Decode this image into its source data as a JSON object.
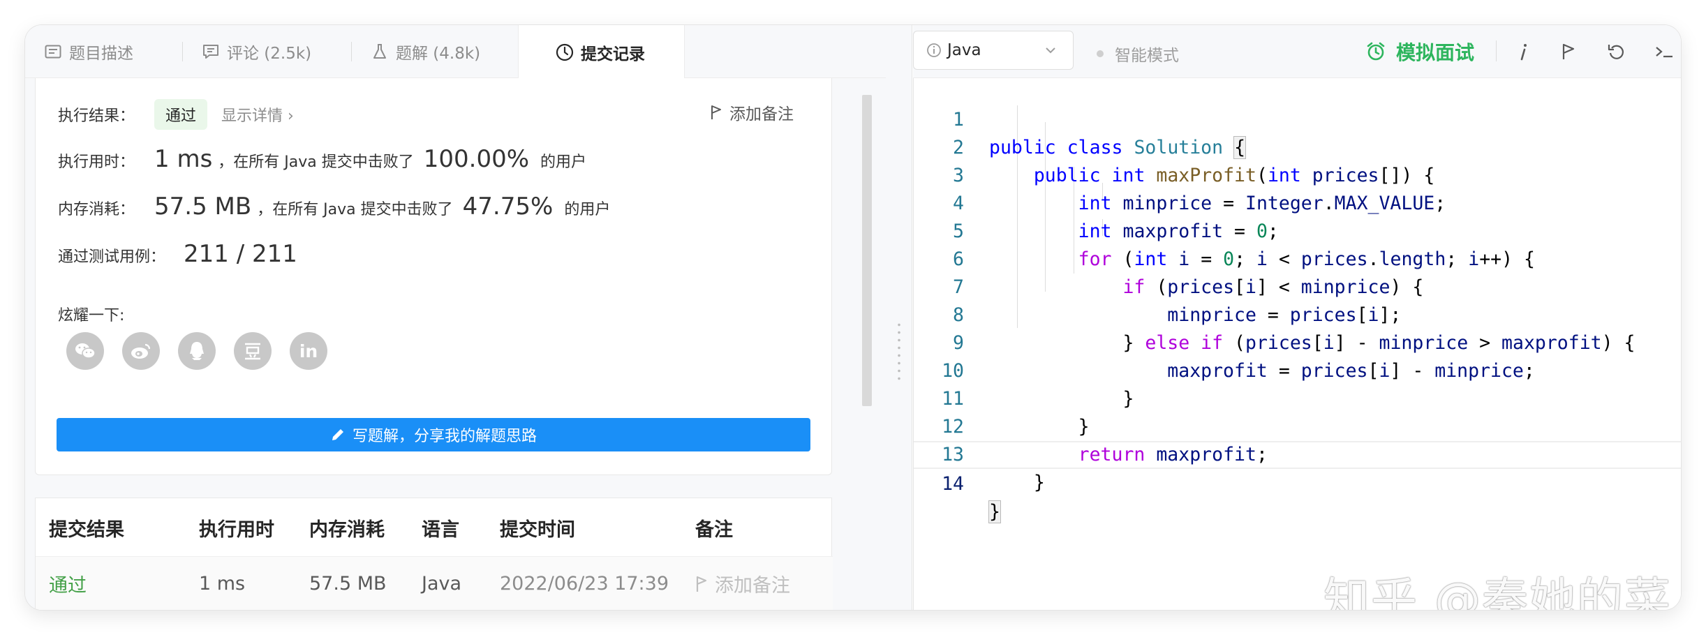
{
  "tabs": [
    {
      "label": "题目描述",
      "icon": "description-icon",
      "active": false
    },
    {
      "label": "评论 (2.5k)",
      "icon": "comment-icon",
      "active": false
    },
    {
      "label": "题解 (4.8k)",
      "icon": "flask-icon",
      "active": false
    },
    {
      "label": "提交记录",
      "icon": "clock-icon",
      "active": true
    }
  ],
  "result": {
    "status_label": "执行结果：",
    "status": "通过",
    "details_link": "显示详情 ›",
    "add_note": "添加备注",
    "time_label": "执行用时：",
    "time_value": "1 ms",
    "time_text": "，在所有 Java 提交中击败了",
    "time_percent": "100.00%",
    "time_suffix": "的用户",
    "mem_label": "内存消耗：",
    "mem_value": "57.5 MB",
    "mem_text": "，在所有 Java 提交中击败了",
    "mem_percent": "47.75%",
    "mem_suffix": "的用户",
    "tests_label": "通过测试用例：",
    "tests_value": "211 / 211",
    "share_label": "炫耀一下:",
    "share_icons": [
      "wechat-icon",
      "weibo-icon",
      "qq-icon",
      "douban-icon",
      "linkedin-icon"
    ],
    "write_button": "写题解，分享我的解题思路"
  },
  "submissions": {
    "headers": [
      "提交结果",
      "执行用时",
      "内存消耗",
      "语言",
      "提交时间",
      "备注"
    ],
    "rows": [
      {
        "result": "通过",
        "time": "1 ms",
        "memory": "57.5 MB",
        "language": "Java",
        "submitted": "2022/06/23 17:39",
        "note": "添加备注"
      }
    ]
  },
  "toolbar": {
    "language": "Java",
    "smart_mode": "智能模式",
    "mock_interview": "模拟面试",
    "accent_color": "#2db55d"
  },
  "editor": {
    "lines": [
      {
        "n": "1"
      },
      {
        "n": "2"
      },
      {
        "n": "3"
      },
      {
        "n": "4"
      },
      {
        "n": "5"
      },
      {
        "n": "6"
      },
      {
        "n": "7"
      },
      {
        "n": "8"
      },
      {
        "n": "9"
      },
      {
        "n": "10"
      },
      {
        "n": "11"
      },
      {
        "n": "12"
      },
      {
        "n": "13"
      },
      {
        "n": "14"
      }
    ],
    "code": {
      "l1": [
        "public",
        "class",
        "Solution",
        "{"
      ],
      "l2": [
        "public",
        "int",
        "maxProfit",
        "(",
        "int",
        "prices",
        "[]) {"
      ],
      "l3": [
        "int",
        "minprice",
        " = ",
        "Integer",
        ".",
        "MAX_VALUE",
        ";"
      ],
      "l4": [
        "int",
        "maxprofit",
        " = ",
        "0",
        ";"
      ],
      "l5": [
        "for",
        " (",
        "int",
        "i",
        " = ",
        "0",
        "; ",
        "i",
        " < ",
        "prices",
        ".",
        "length",
        "; ",
        "i",
        "++) {"
      ],
      "l6": [
        "if",
        " (",
        "prices",
        "[",
        "i",
        "] < ",
        "minprice",
        ") {"
      ],
      "l7": [
        "minprice",
        " = ",
        "prices",
        "[",
        "i",
        "];"
      ],
      "l8": [
        "} ",
        "else",
        " ",
        "if",
        " (",
        "prices",
        "[",
        "i",
        "] - ",
        "minprice",
        " > ",
        "maxprofit",
        ") {"
      ],
      "l9": [
        "maxprofit",
        " = ",
        "prices",
        "[",
        "i",
        "] - ",
        "minprice",
        ";"
      ],
      "l10": [
        "}"
      ],
      "l11": [
        "}"
      ],
      "l12": [
        "return",
        "maxprofit",
        ";"
      ],
      "l13": [
        "}"
      ],
      "l14": [
        "}"
      ]
    }
  },
  "watermark": "知乎 @秦她的菜"
}
